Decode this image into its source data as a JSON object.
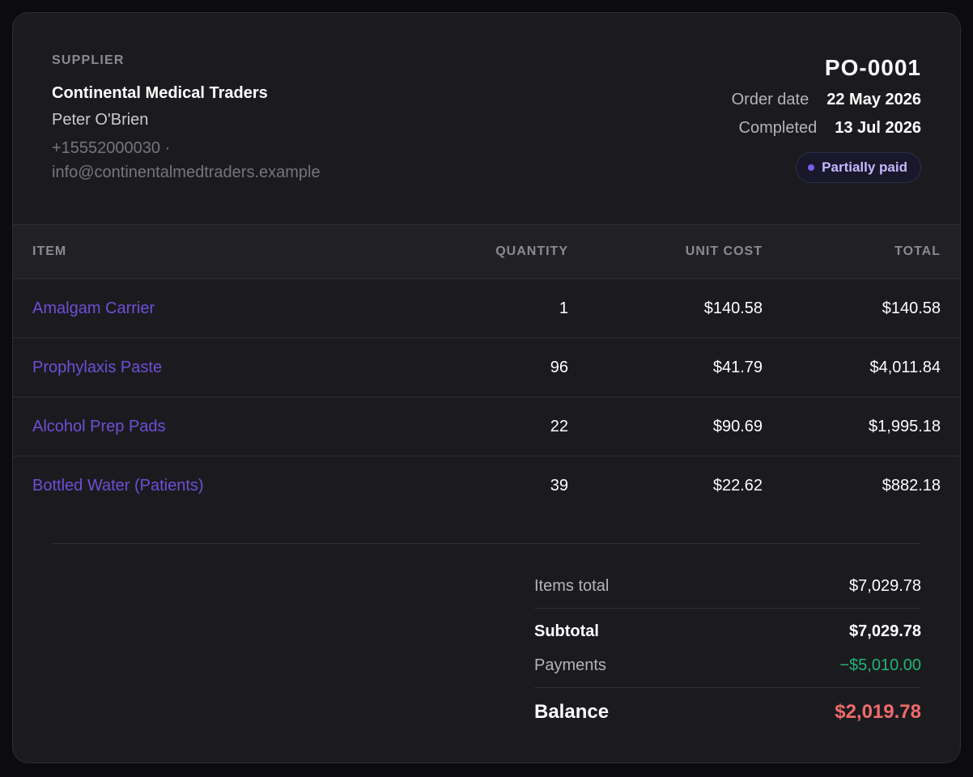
{
  "supplier": {
    "eyebrow": "SUPPLIER",
    "name": "Continental Medical Traders",
    "contact": "Peter O'Brien",
    "phone": "+15552000030 ·",
    "email": "info@continentalmedtraders.example"
  },
  "order": {
    "number": "PO-0001",
    "order_date_label": "Order date",
    "order_date": "22 May 2026",
    "completed_label": "Completed",
    "completed": "13 Jul 2026",
    "status": "Partially paid"
  },
  "table": {
    "headers": [
      "ITEM",
      "QUANTITY",
      "UNIT COST",
      "TOTAL"
    ],
    "rows": [
      {
        "item": "Amalgam Carrier",
        "quantity": "1",
        "unit_cost": "$140.58",
        "total": "$140.58"
      },
      {
        "item": "Prophylaxis Paste",
        "quantity": "96",
        "unit_cost": "$41.79",
        "total": "$4,011.84"
      },
      {
        "item": "Alcohol Prep Pads",
        "quantity": "22",
        "unit_cost": "$90.69",
        "total": "$1,995.18"
      },
      {
        "item": "Bottled Water (Patients)",
        "quantity": "39",
        "unit_cost": "$22.62",
        "total": "$882.18"
      }
    ]
  },
  "summary": {
    "items_total_label": "Items total",
    "items_total": "$7,029.78",
    "subtotal_label": "Subtotal",
    "subtotal": "$7,029.78",
    "payments_label": "Payments",
    "payments": "−$5,010.00",
    "balance_label": "Balance",
    "balance": "$2,019.78"
  },
  "colors": {
    "background": "#0c0c0e",
    "card": "#1b1b1f",
    "link": "#6d4fd6",
    "payment_green": "#22b573",
    "balance_red": "#ef6b6b",
    "badge_text": "#c7b6ff"
  }
}
